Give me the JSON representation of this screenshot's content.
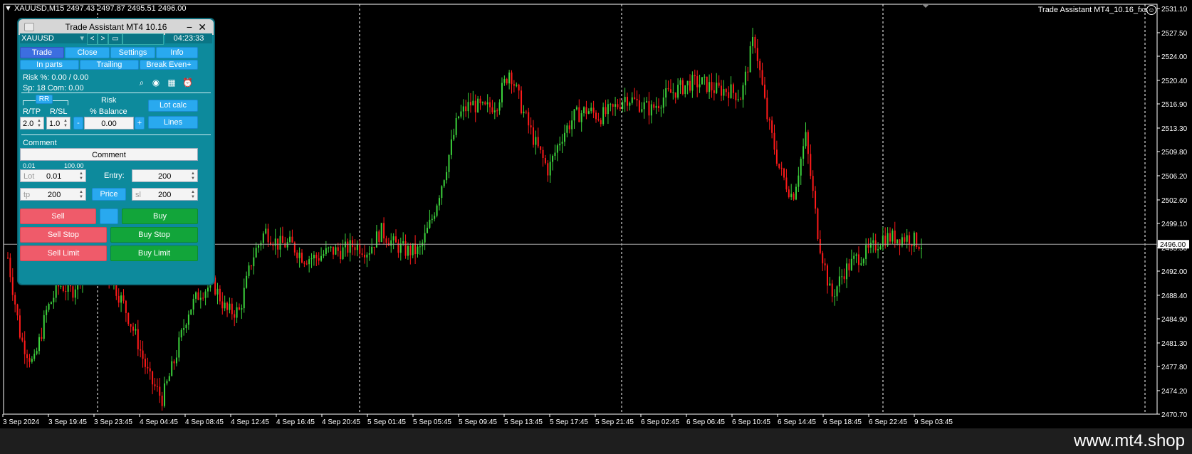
{
  "chart": {
    "header": "XAUUSD,M15  2497.43 2497.87 2495.51 2496.00",
    "ea_label": "Trade Assistant MT4_10.16_fxs",
    "current_price": "2496.00",
    "price_ticks": [
      "2531.10",
      "2527.50",
      "2524.00",
      "2520.40",
      "2516.90",
      "2513.30",
      "2509.80",
      "2506.20",
      "2502.60",
      "2499.10",
      "2495.50",
      "2492.00",
      "2488.40",
      "2484.90",
      "2481.30",
      "2477.80",
      "2474.20",
      "2470.70"
    ],
    "time_ticks": [
      "3 Sep 2024",
      "3 Sep 19:45",
      "3 Sep 23:45",
      "4 Sep 04:45",
      "4 Sep 08:45",
      "4 Sep 12:45",
      "4 Sep 16:45",
      "4 Sep 20:45",
      "5 Sep 01:45",
      "5 Sep 05:45",
      "5 Sep 09:45",
      "5 Sep 13:45",
      "5 Sep 17:45",
      "5 Sep 21:45",
      "6 Sep 02:45",
      "6 Sep 06:45",
      "6 Sep 10:45",
      "6 Sep 14:45",
      "6 Sep 18:45",
      "6 Sep 22:45",
      "9 Sep 03:45"
    ],
    "colors": {
      "bull": "#3cd23c",
      "bear": "#ff1a1a",
      "grid": "#ffffff",
      "axis": "#ffffff"
    },
    "price_path": [
      2494,
      2482,
      2478,
      2486,
      2490,
      2489,
      2493,
      2493,
      2491,
      2487,
      2482,
      2476,
      2473,
      2479,
      2486,
      2489,
      2490,
      2486,
      2486,
      2494,
      2498,
      2496,
      2496,
      2494,
      2494,
      2495,
      2495,
      2496,
      2495,
      2498,
      2496,
      2495,
      2495,
      2500,
      2507,
      2515,
      2517,
      2516,
      2517,
      2522,
      2516,
      2511,
      2507,
      2512,
      2515,
      2516,
      2515,
      2516,
      2518,
      2517,
      2516,
      2518,
      2519,
      2520,
      2520,
      2519,
      2519,
      2518,
      2527,
      2515,
      2507,
      2503,
      2512,
      2497,
      2488,
      2492,
      2494,
      2495,
      2497,
      2497,
      2497,
      2496
    ]
  },
  "panel": {
    "title": "Trade Assistant MT4 10.16",
    "minimize": "−",
    "close": "✕",
    "symbol": "XAUUSD",
    "symbol_arrow": "▾",
    "prev": "<",
    "next": ">",
    "time": "04:23:33",
    "tabs": [
      "Trade",
      "Close",
      "Settings",
      "Info"
    ],
    "subtabs": [
      "In parts",
      "Trailing",
      "Break Even+"
    ],
    "risk_info": "Risk %: 0.00 /  0.00",
    "spread_info": "Sp: 18  Com: 0.00",
    "rr_label": "RR",
    "rtp_label": "R/TP",
    "rsl_label": "R/SL",
    "risk_label": "Risk",
    "balance_label": "% Balance",
    "rtp_value": "2.0",
    "rsl_value": "1.0",
    "minus": "-",
    "plus": "+",
    "risk_value": "0.00",
    "lot_calc": "Lot calc",
    "lines": "Lines",
    "comment_label": "Comment",
    "comment_value": "Comment",
    "lot_min": "0.01",
    "lot_max": "100.00",
    "lot_placeholder": "Lot",
    "lot_value": "0.01",
    "entry_label": "Entry:",
    "entry_value": "200",
    "tp_placeholder": "tp",
    "tp_value": "200",
    "price_button": "Price",
    "sl_placeholder": "sl",
    "sl_value": "200",
    "sell": "Sell",
    "buy": "Buy",
    "sell_stop": "Sell Stop",
    "buy_stop": "Buy Stop",
    "sell_limit": "Sell Limit",
    "buy_limit": "Buy Limit"
  },
  "footer": {
    "site": "www.mt4.shop"
  }
}
